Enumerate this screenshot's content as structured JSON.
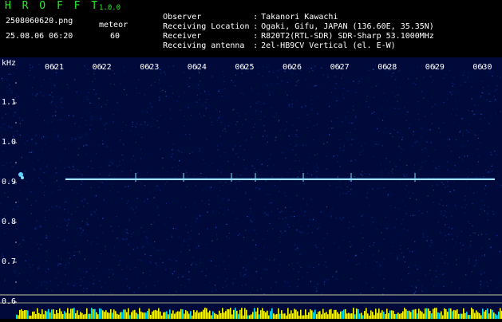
{
  "header": {
    "app_title": "H R O F F T",
    "app_version": "1.0.0",
    "filename": "2508060620.png",
    "meteor_label": "meteor",
    "datetime": "25.08.06 06:20",
    "meteor_count": "60",
    "info": [
      {
        "label": "Observer",
        "value": "Takanori Kawachi"
      },
      {
        "label": "Receiving Location",
        "value": "Ogaki, Gifu, JAPAN (136.60E, 35.35N)"
      },
      {
        "label": "Receiver",
        "value": "R820T2(RTL-SDR) SDR-Sharp 53.1000MHz"
      },
      {
        "label": "Receiving antenna",
        "value": "2el-HB9CV Vertical (el. E-W)"
      }
    ]
  },
  "spectrogram": {
    "unit_label": "kHz",
    "time_ticks": [
      "0621",
      "0622",
      "0623",
      "0624",
      "0625",
      "0626",
      "0627",
      "0628",
      "0629",
      "0630"
    ],
    "freq_ticks": [
      "1.1",
      "1.0",
      "0.9",
      "0.8",
      "0.7",
      "0.6"
    ],
    "colors": {
      "background": "#000a3a",
      "signal": "#a8e8ff",
      "tick": "#ffffff",
      "bars": "#ffff00"
    }
  }
}
